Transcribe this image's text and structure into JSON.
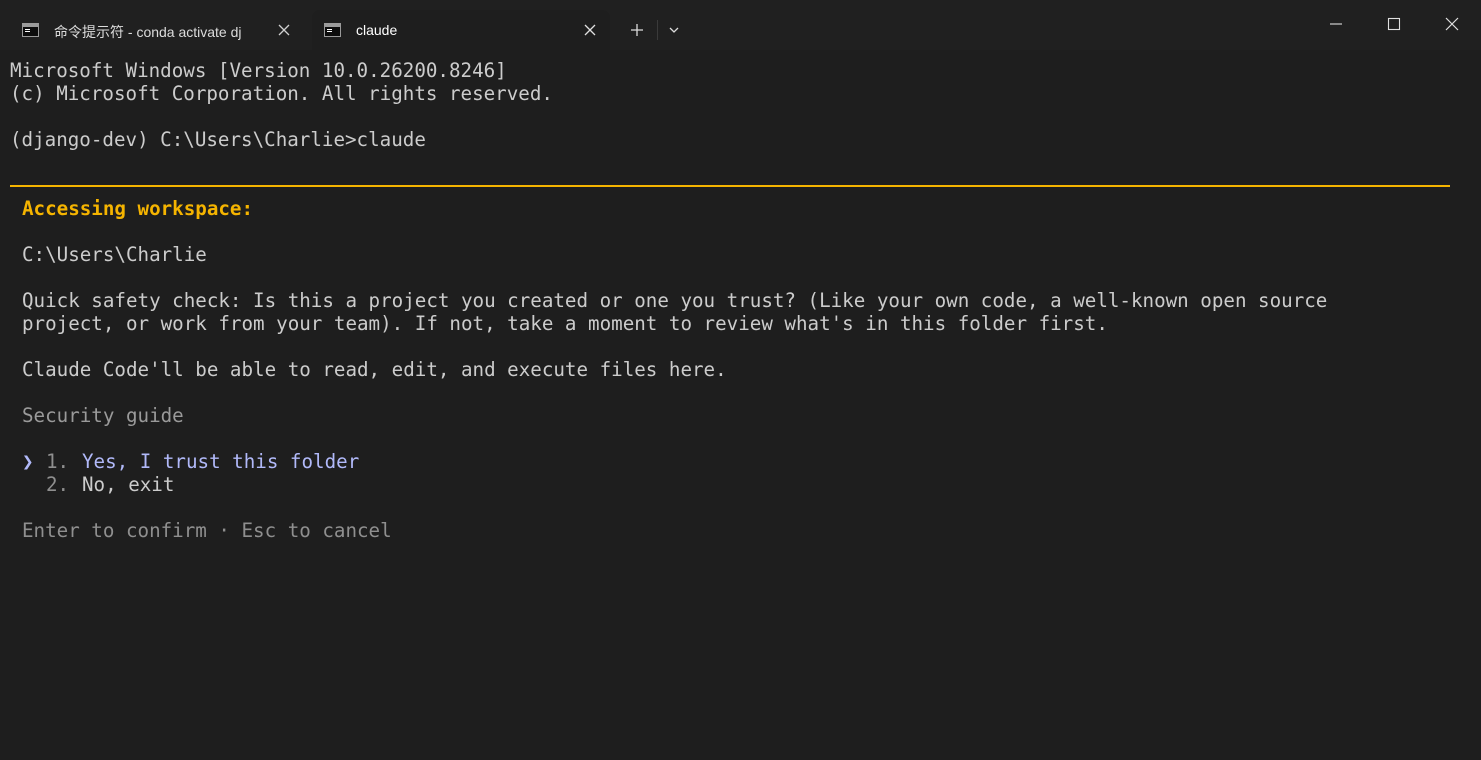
{
  "tabs": [
    {
      "title": "命令提示符 - conda  activate dj",
      "icon": "cmd-icon",
      "active": false
    },
    {
      "title": "claude",
      "icon": "cmd-icon",
      "active": true
    }
  ],
  "titlebar": {
    "new_tab_icon": "plus-icon",
    "dropdown_icon": "chevron-down-icon",
    "minimize_icon": "minimize-icon",
    "maximize_icon": "maximize-icon",
    "close_icon": "close-icon"
  },
  "terminal": {
    "version_line": "Microsoft Windows [Version 10.0.26200.8246]",
    "copyright_line": "(c) Microsoft Corporation. All rights reserved.",
    "prompt_line": "(django-dev) C:\\Users\\Charlie>claude"
  },
  "dialog": {
    "title": "Accessing workspace:",
    "path": "C:\\Users\\Charlie",
    "question_line1": "Quick safety check: Is this a project you created or one you trust? (Like your own code, a well-known open source",
    "question_line2": "project, or work from your team). If not, take a moment to review what's in this folder first.",
    "ability": "Claude Code'll be able to read, edit, and execute files here.",
    "security_guide": "Security guide",
    "options": [
      {
        "pointer": "❯",
        "number": "1.",
        "label": "Yes, I trust this folder",
        "selected": true
      },
      {
        "pointer": " ",
        "number": "2.",
        "label": "No, exit",
        "selected": false
      }
    ],
    "hint": "Enter to confirm · Esc to cancel"
  },
  "colors": {
    "background": "#1e1e1e",
    "accent": "#f5b400",
    "selected_option": "#b1b9f9",
    "text": "#cccccc",
    "dim_text": "#8f8f8f"
  }
}
